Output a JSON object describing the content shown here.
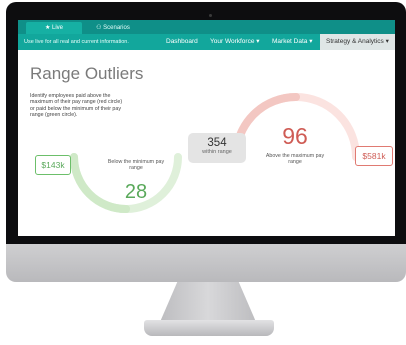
{
  "tabs": [
    {
      "label": "★ Live"
    },
    {
      "label": "⚇ Scenarios"
    }
  ],
  "subbar": {
    "info": "Use live for all real and current information.",
    "nav": [
      "Dashboard",
      "Your Workforce ▾",
      "Market Data ▾",
      "Strategy & Analytics ▾"
    ]
  },
  "page": {
    "title": "Range Outliers",
    "description": "Identify employees paid above the maximum of their pay range (red circle) or paid below the minimum of their pay range (green circle)."
  },
  "below": {
    "amount": "$143k",
    "label": "Below the minimum pay range",
    "count": "28",
    "level": 0.5
  },
  "within": {
    "count": "354",
    "label": "within range"
  },
  "above": {
    "amount": "$581k",
    "label": "Above the maximum pay range",
    "count": "96",
    "level": 0.5
  },
  "colors": {
    "teal_dark": "#0f8f88",
    "teal": "#12a79c",
    "green": "#6cbf6a",
    "green_light": "#cfe9c7",
    "red": "#e07a72",
    "red_light": "#f3c7c2"
  }
}
